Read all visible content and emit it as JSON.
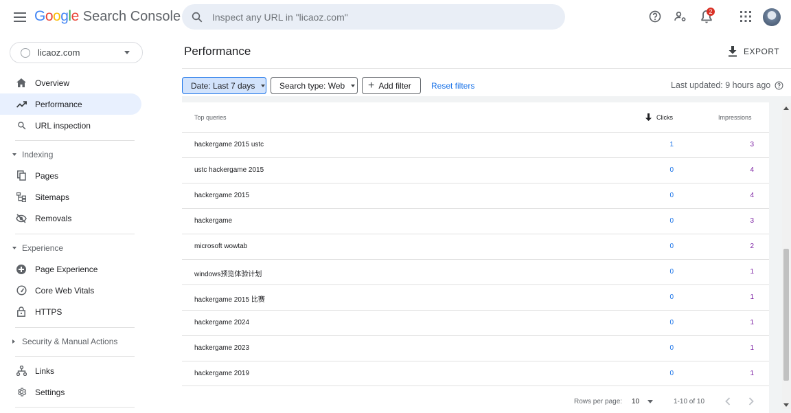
{
  "app": {
    "logo_google": "Google",
    "logo_product": "Search Console",
    "search_placeholder": "Inspect any URL in \"licaoz.com\"",
    "notification_count": "2",
    "logo_colors": [
      "#4285f4",
      "#ea4335",
      "#fbbc05",
      "#4285f4",
      "#34a853",
      "#ea4335"
    ]
  },
  "property": {
    "name": "licaoz.com"
  },
  "sidebar": {
    "items": [
      {
        "label": "Overview",
        "icon": "home-icon"
      },
      {
        "label": "Performance",
        "icon": "trending-up-icon",
        "active": true
      },
      {
        "label": "URL inspection",
        "icon": "search-icon"
      }
    ],
    "sections": {
      "indexing": {
        "label": "Indexing",
        "items": [
          {
            "label": "Pages",
            "icon": "pages-icon"
          },
          {
            "label": "Sitemaps",
            "icon": "sitemap-icon"
          },
          {
            "label": "Removals",
            "icon": "visibility-off-icon"
          }
        ]
      },
      "experience": {
        "label": "Experience",
        "items": [
          {
            "label": "Page Experience",
            "icon": "plus-circle-icon"
          },
          {
            "label": "Core Web Vitals",
            "icon": "speed-icon"
          },
          {
            "label": "HTTPS",
            "icon": "lock-icon"
          }
        ]
      },
      "security": {
        "label": "Security & Manual Actions"
      }
    },
    "bottom_items": [
      {
        "label": "Links",
        "icon": "links-icon"
      },
      {
        "label": "Settings",
        "icon": "gear-icon"
      }
    ]
  },
  "main": {
    "title": "Performance",
    "export_label": "EXPORT",
    "filters": {
      "date": "Date: Last 7 days",
      "search_type": "Search type: Web",
      "add_filter": "Add filter",
      "reset": "Reset filters"
    },
    "last_updated": "Last updated: 9 hours ago",
    "table": {
      "headers": {
        "query": "Top queries",
        "clicks": "Clicks",
        "impressions": "Impressions"
      },
      "rows": [
        {
          "query": "hackergame 2015 ustc",
          "clicks": "1",
          "impressions": "3"
        },
        {
          "query": "ustc hackergame 2015",
          "clicks": "0",
          "impressions": "4"
        },
        {
          "query": "hackergame 2015",
          "clicks": "0",
          "impressions": "4"
        },
        {
          "query": "hackergame",
          "clicks": "0",
          "impressions": "3"
        },
        {
          "query": "microsoft wowtab",
          "clicks": "0",
          "impressions": "2"
        },
        {
          "query": "windows预览体验计划",
          "clicks": "0",
          "impressions": "1"
        },
        {
          "query": "hackergame 2015 比赛",
          "clicks": "0",
          "impressions": "1"
        },
        {
          "query": "hackergame 2024",
          "clicks": "0",
          "impressions": "1"
        },
        {
          "query": "hackergame 2023",
          "clicks": "0",
          "impressions": "1"
        },
        {
          "query": "hackergame 2019",
          "clicks": "0",
          "impressions": "1"
        }
      ]
    },
    "pagination": {
      "rows_label": "Rows per page:",
      "rows_value": "10",
      "range": "1-10 of 10"
    }
  },
  "colors": {
    "accent": "#1a73e8",
    "clicks": "#1a73e8",
    "impressions": "#7b1fa2",
    "active_bg": "#e8f0fe"
  }
}
